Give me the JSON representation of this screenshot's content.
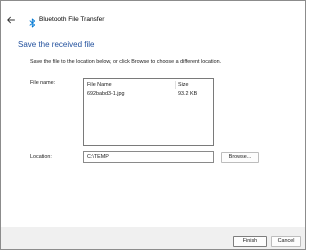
{
  "window": {
    "title": "Bluetooth File Transfer"
  },
  "main": {
    "heading": "Save the received file",
    "instruction": "Save the file to the location below, or click Browse to choose a different location.",
    "file_name_label": "File name:",
    "file_table": {
      "columns": [
        "File Name",
        "Size"
      ],
      "rows": [
        {
          "name": "692babd3-1.jpg",
          "size": "93.2 KB"
        }
      ]
    },
    "location_label": "Location:",
    "location_value": "C:\\TEMP",
    "browse_label": "Browse..."
  },
  "footer": {
    "finish_label": "Finish",
    "cancel_label": "Cancel"
  },
  "icons": {
    "back": "back-arrow-icon",
    "bluetooth": "bluetooth-icon"
  },
  "colors": {
    "heading": "#1f4e9c",
    "bluetooth": "#0078d4",
    "footer_bg": "#f0f0f0"
  }
}
